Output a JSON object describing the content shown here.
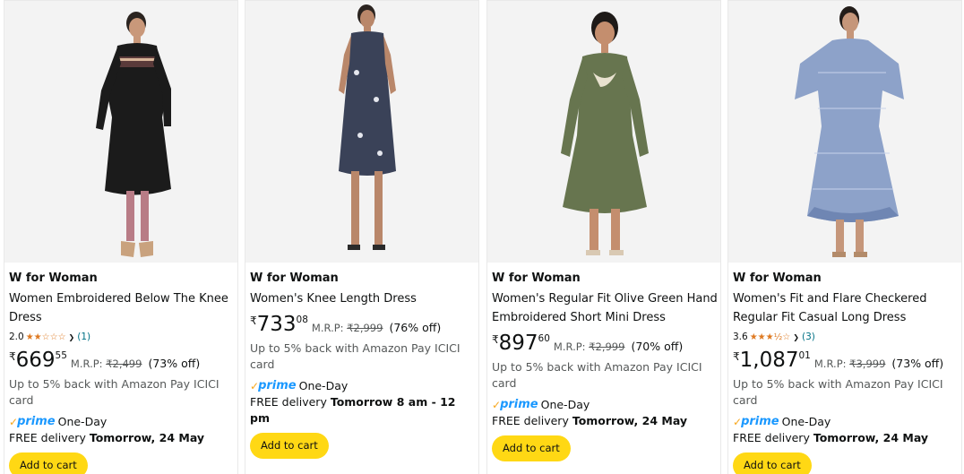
{
  "products": [
    {
      "brand": "W for Woman",
      "title": "Women Embroidered Below The Knee Dress",
      "rating": "2.0",
      "stars": "★★☆☆☆",
      "review_count": "(1)",
      "currency": "₹",
      "price_whole": "669",
      "price_fraction": "55",
      "mrp_label": "M.R.P:",
      "mrp": "₹2,499",
      "discount": "(73% off)",
      "cashback": "Up to 5% back with Amazon Pay ICICI card",
      "prime_label": "prime",
      "prime_speed": "One-Day",
      "delivery_prefix": "FREE delivery",
      "delivery_date": "Tomorrow, 24 May",
      "add_to_cart": "Add to cart"
    },
    {
      "brand": "W for Woman",
      "title": "Women's Knee Length Dress",
      "currency": "₹",
      "price_whole": "733",
      "price_fraction": "08",
      "mrp_label": "M.R.P:",
      "mrp": "₹2,999",
      "discount": "(76% off)",
      "cashback": "Up to 5% back with Amazon Pay ICICI card",
      "prime_label": "prime",
      "prime_speed": "One-Day",
      "delivery_prefix": "FREE delivery",
      "delivery_date": "Tomorrow 8 am - 12 pm",
      "add_to_cart": "Add to cart"
    },
    {
      "brand": "W for Woman",
      "title": "Women's Regular Fit Olive Green Hand Embroidered Short Mini Dress",
      "currency": "₹",
      "price_whole": "897",
      "price_fraction": "60",
      "mrp_label": "M.R.P:",
      "mrp": "₹2,999",
      "discount": "(70% off)",
      "cashback": "Up to 5% back with Amazon Pay ICICI card",
      "prime_label": "prime",
      "prime_speed": "One-Day",
      "delivery_prefix": "FREE delivery",
      "delivery_date": "Tomorrow, 24 May",
      "add_to_cart": "Add to cart"
    },
    {
      "brand": "W for Woman",
      "title": "Women's Fit and Flare Checkered Regular Fit Casual Long Dress",
      "rating": "3.6",
      "stars": "★★★½☆",
      "review_count": "(3)",
      "currency": "₹",
      "price_whole": "1,087",
      "price_fraction": "01",
      "mrp_label": "M.R.P:",
      "mrp": "₹3,999",
      "discount": "(73% off)",
      "cashback": "Up to 5% back with Amazon Pay ICICI card",
      "prime_label": "prime",
      "prime_speed": "One-Day",
      "delivery_prefix": "FREE delivery",
      "delivery_date": "Tomorrow, 24 May",
      "add_to_cart": "Add to cart"
    }
  ],
  "colors": {
    "button": "#FFD814",
    "star": "#de7921",
    "link": "#007185",
    "prime": "#1a98ff",
    "prime_check": "#f7a71d"
  }
}
